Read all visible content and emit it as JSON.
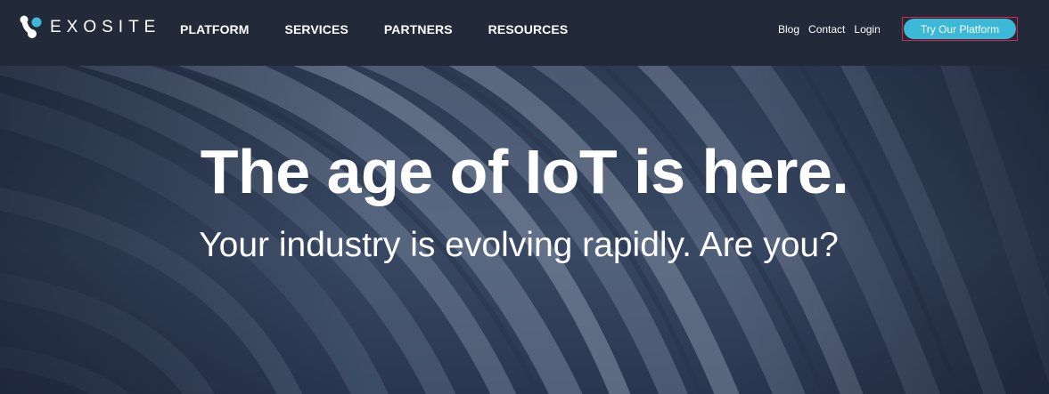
{
  "header": {
    "logo_text": "EXOSITE",
    "logo_icon": "exosite-logo-icon",
    "nav": [
      {
        "label": "PLATFORM"
      },
      {
        "label": "SERVICES"
      },
      {
        "label": "PARTNERS"
      },
      {
        "label": "RESOURCES"
      }
    ],
    "util_links": [
      {
        "label": "Blog"
      },
      {
        "label": "Contact"
      },
      {
        "label": "Login"
      }
    ],
    "cta_label": "Try Our Platform"
  },
  "hero": {
    "title": "The age of IoT is here.",
    "subtitle": "Your industry is evolving rapidly. Are you?"
  },
  "colors": {
    "header_bg": "#222938",
    "cta_bg": "#3bb9d7",
    "cta_outline": "#e0224a",
    "logo_accent": "#3bb9d7",
    "hero_bg": "#344460"
  }
}
